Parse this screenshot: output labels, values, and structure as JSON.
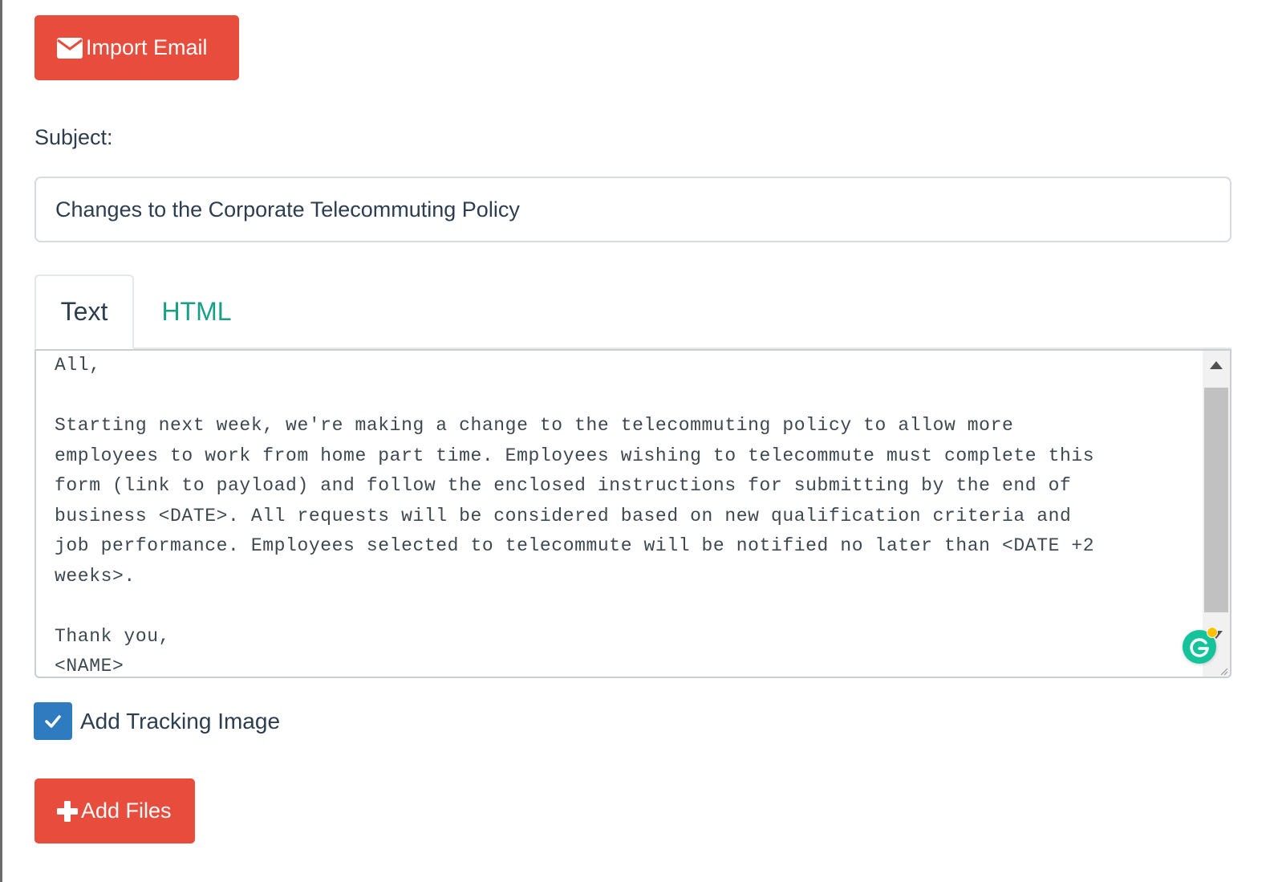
{
  "import_button": {
    "label": "Import Email",
    "icon": "envelope-icon"
  },
  "subject": {
    "label": "Subject:",
    "value": "Changes to the Corporate Telecommuting Policy"
  },
  "tabs": [
    {
      "label": "Text",
      "active": true
    },
    {
      "label": "HTML",
      "active": false
    }
  ],
  "editor": {
    "content": "All,\n\nStarting next week, we're making a change to the telecommuting policy to allow more\nemployees to work from home part time. Employees wishing to telecommute must complete this\nform (link to payload) and follow the enclosed instructions for submitting by the end of\nbusiness <DATE>. All requests will be considered based on new qualification criteria and\njob performance. Employees selected to telecommute will be notified no later than <DATE +2\nweeks>.\n\nThank you,\n<NAME>"
  },
  "tracking": {
    "label": "Add Tracking Image",
    "checked": true
  },
  "add_files_button": {
    "label": "Add Files",
    "icon": "plus-icon"
  },
  "colors": {
    "button_red": "#e74c3c",
    "tab_link": "#18a085",
    "checkbox_blue": "#2e7bbf",
    "grammarly_green": "#15c39a"
  }
}
